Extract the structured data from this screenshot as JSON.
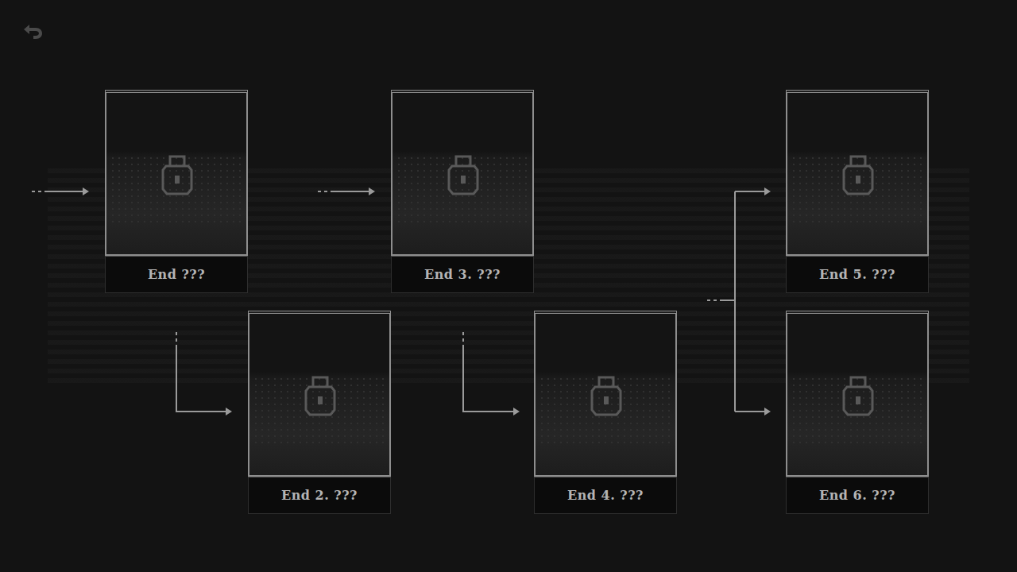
{
  "endings": [
    {
      "label": "End ???",
      "locked": true
    },
    {
      "label": "End 2. ???",
      "locked": true
    },
    {
      "label": "End 3. ???",
      "locked": true
    },
    {
      "label": "End 4. ???",
      "locked": true
    },
    {
      "label": "End 5. ???",
      "locked": true
    },
    {
      "label": "End 6. ???",
      "locked": true
    }
  ]
}
